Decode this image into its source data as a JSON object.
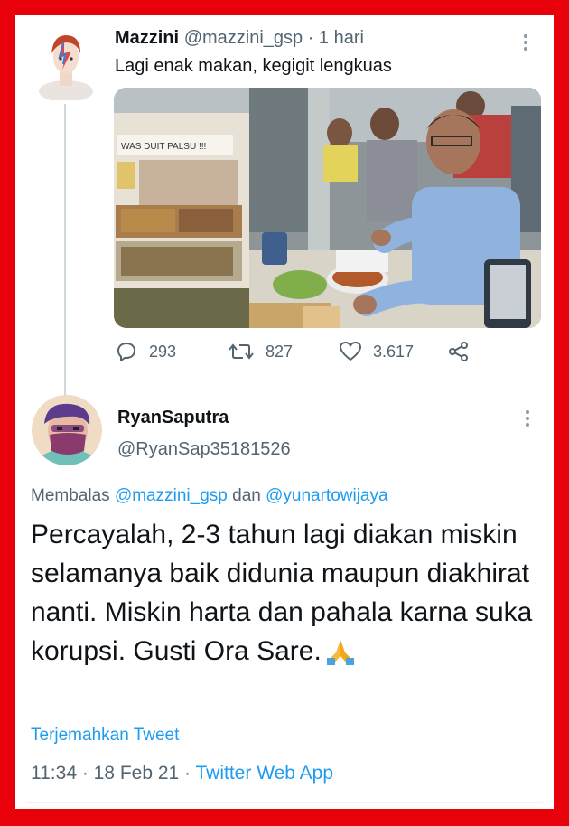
{
  "parent_tweet": {
    "name": "Mazzini",
    "handle": "@mazzini_gsp",
    "time": "· 1 hari",
    "text": "Lagi enak makan, kegigit lengkuas",
    "photo_sign": "WAS DUIT PALSU !!!",
    "stats": {
      "replies": "293",
      "retweets": "827",
      "likes": "3.617"
    }
  },
  "reply_tweet": {
    "name": "RyanSaputra",
    "handle": "@RyanSap35181526",
    "replying_prefix": "Membalas",
    "mention1": "@mazzini_gsp",
    "replying_join": "dan",
    "mention2": "@yunartowijaya",
    "body": "Percayalah, 2-3 tahun lagi diakan miskin selamanya baik didunia maupun diakhirat nanti. Miskin harta dan pahala karna suka korupsi. Gusti Ora Sare.",
    "translate": "Terjemahkan Tweet",
    "time": "11:34 · 18 Feb 21 · ",
    "source": "Twitter Web App"
  },
  "colors": {
    "frame": "#e8000b",
    "accent": "#1d9bf0",
    "secondary": "#536471"
  },
  "icons": [
    "avatar-david-bowie",
    "more-icon",
    "reply-icon",
    "retweet-icon",
    "like-icon",
    "share-icon",
    "avatar-masked-man",
    "folded-hands-emoji"
  ]
}
